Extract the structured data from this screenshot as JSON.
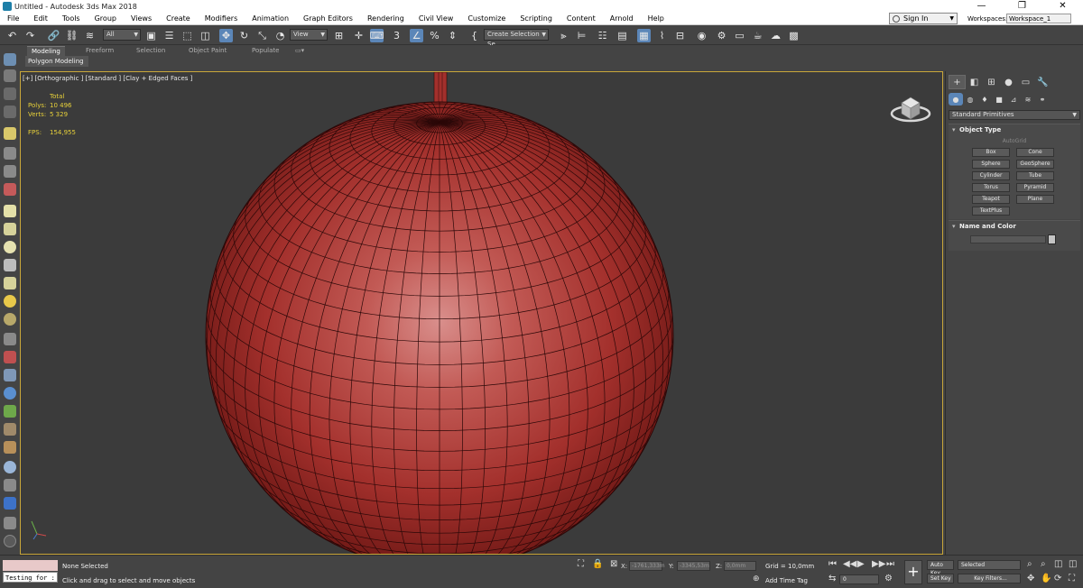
{
  "window": {
    "title": "Untitled - Autodesk 3ds Max 2018",
    "controls": [
      "—",
      "❐",
      "✕"
    ]
  },
  "menu": {
    "items": [
      "File",
      "Edit",
      "Tools",
      "Group",
      "Views",
      "Create",
      "Modifiers",
      "Animation",
      "Graph Editors",
      "Rendering",
      "Civil View",
      "Customize",
      "Scripting",
      "Content",
      "Arnold",
      "Help"
    ],
    "sign_in": "Sign In",
    "workspaces_label": "Workspaces:",
    "workspace_value": "Workspace_1"
  },
  "toolbar": {
    "selection_filter": "All",
    "ref_coord": "View",
    "named_selection": "Create Selection Se",
    "snap_label": "3"
  },
  "ribbon": {
    "tabs": [
      "Modeling",
      "Freeform",
      "Selection",
      "Object Paint",
      "Populate"
    ],
    "active_panel": "Polygon Modeling"
  },
  "viewport": {
    "label": "[+] [Orthographic ] [Standard ] [Clay + Edged Faces ]",
    "stats": {
      "header": "Total",
      "polys_label": "Polys:",
      "polys_value": "10 496",
      "verts_label": "Verts:",
      "verts_value": "5 329",
      "fps_label": "FPS:",
      "fps_value": "154,955"
    },
    "sphere_color": "#b23a35",
    "border_color": "#c9a73a"
  },
  "command_panel": {
    "category": "Standard Primitives",
    "object_type_title": "Object Type",
    "autogrid": "AutoGrid",
    "buttons": [
      "Box",
      "Cone",
      "Sphere",
      "GeoSphere",
      "Cylinder",
      "Tube",
      "Torus",
      "Pyramid",
      "Teapot",
      "Plane",
      "TextPlus"
    ],
    "name_color_title": "Name and Color"
  },
  "status": {
    "selection": "None Selected",
    "prompt": "Click and drag to select and move objects",
    "testing": "Testing for :",
    "x_label": "X:",
    "x_value": "-1761,333m",
    "y_label": "Y:",
    "y_value": "-3345,53m",
    "z_label": "Z:",
    "z_value": "0,0mm",
    "grid": "Grid = 10,0mm",
    "add_time_tag": "Add Time Tag",
    "frame": "0",
    "auto_key": "Auto Key",
    "set_key": "Set Key",
    "selected_dd": "Selected",
    "key_filters": "Key Filters..."
  }
}
